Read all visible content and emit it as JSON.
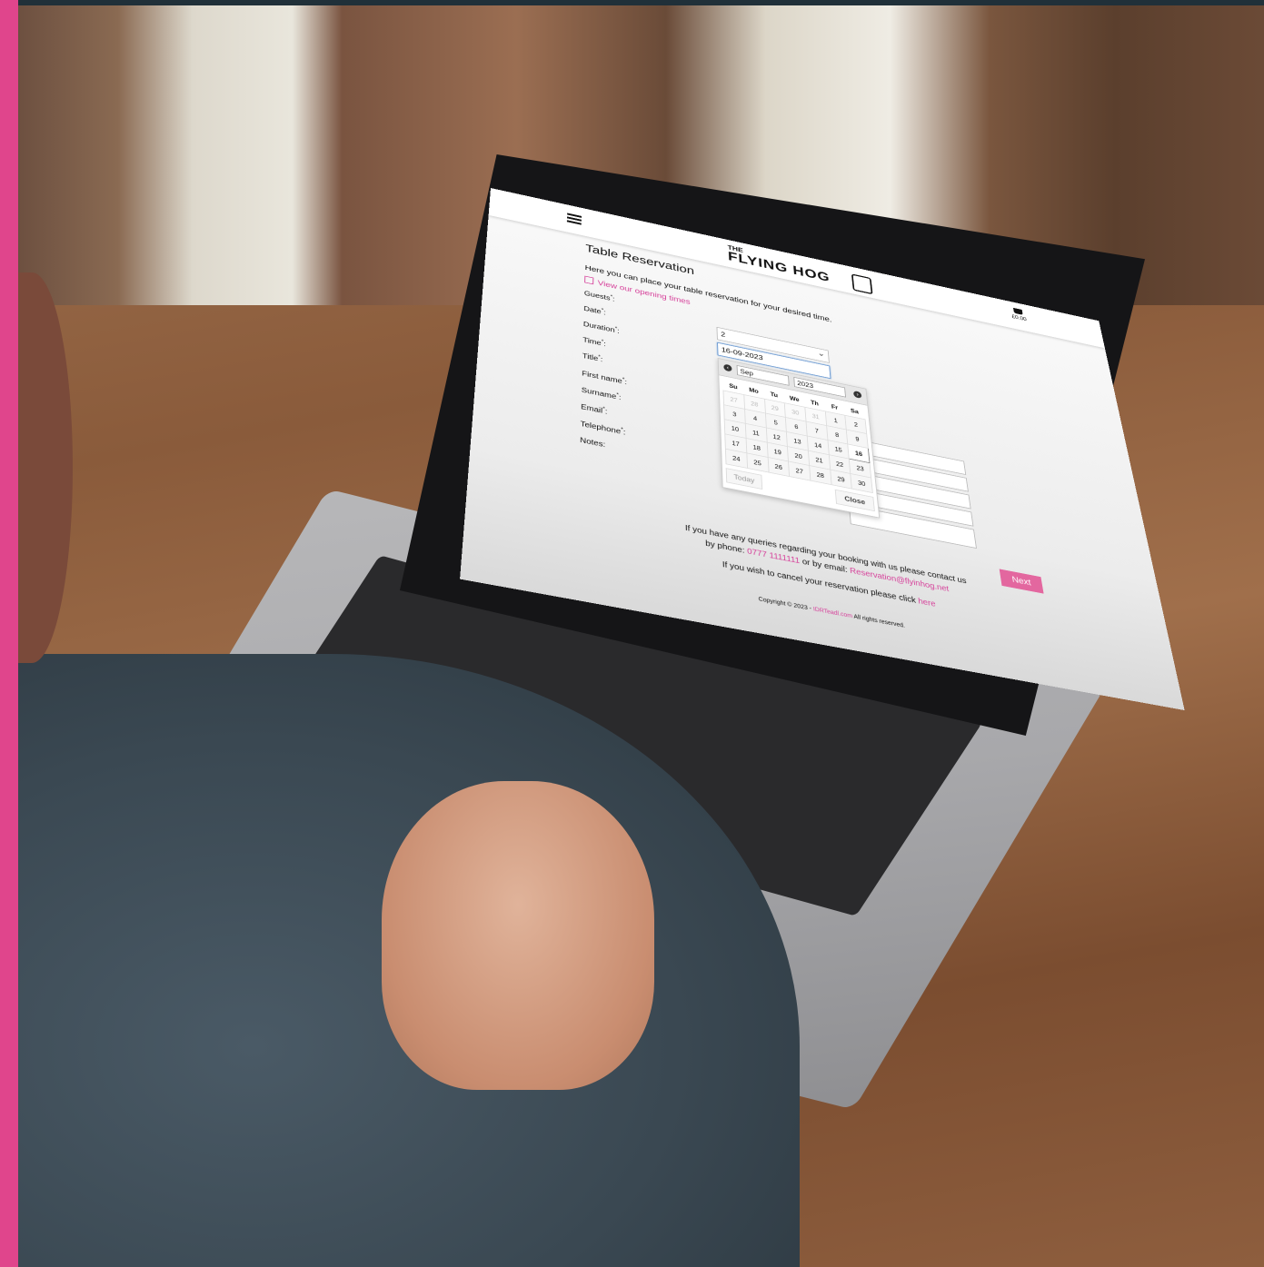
{
  "site": {
    "logo_small": "THE",
    "logo_big": "FLYING HOG",
    "basket_total": "£0.00"
  },
  "page": {
    "title": "Table Reservation",
    "intro": "Here you can place your table reservation for your desired time.",
    "opening_link": "View our opening times"
  },
  "form": {
    "labels": [
      "Guests",
      "Date",
      "Duration",
      "Time",
      "Title",
      "First name",
      "Surname",
      "Email",
      "Telephone",
      "Notes:"
    ],
    "required_mark": "*",
    "guests_value": "2",
    "date_value": "16-09-2023"
  },
  "datepicker": {
    "month": "Sep",
    "year": "2023",
    "weekdays": [
      "Su",
      "Mo",
      "Tu",
      "We",
      "Th",
      "Fr",
      "Sa"
    ],
    "weeks": [
      [
        "27",
        "28",
        "29",
        "30",
        "31",
        "1",
        "2"
      ],
      [
        "3",
        "4",
        "5",
        "6",
        "7",
        "8",
        "9"
      ],
      [
        "10",
        "11",
        "12",
        "13",
        "14",
        "15",
        "16"
      ],
      [
        "17",
        "18",
        "19",
        "20",
        "21",
        "22",
        "23"
      ],
      [
        "24",
        "25",
        "26",
        "27",
        "28",
        "29",
        "30"
      ]
    ],
    "other_month_cells": [
      "0-0",
      "0-1",
      "0-2",
      "0-3",
      "0-4"
    ],
    "selected_cell": "2-6",
    "today_label": "Today",
    "close_label": "Close"
  },
  "actions": {
    "next_label": "Next"
  },
  "footer": {
    "queries_line1": "If you have any queries regarding your booking with us please contact us",
    "by_phone": "by phone:",
    "phone": "0777 1111111",
    "or_by_email": "or by email:",
    "email": "Reservation@flyinhog.net",
    "cancel_text": "If you wish to cancel your reservation please click",
    "cancel_link": "here",
    "copyright_prefix": "Copyright © 2023 -",
    "copyright_link": "IDRTeadl.com",
    "copyright_suffix": "All rights reserved."
  },
  "colors": {
    "accent": "#d6409a",
    "next_button": "#e3679f",
    "frame_bar": "#e0458c"
  },
  "icons": [
    "menu-icon",
    "calendar-icon",
    "basket-icon",
    "prev-month-icon",
    "next-month-icon"
  ]
}
